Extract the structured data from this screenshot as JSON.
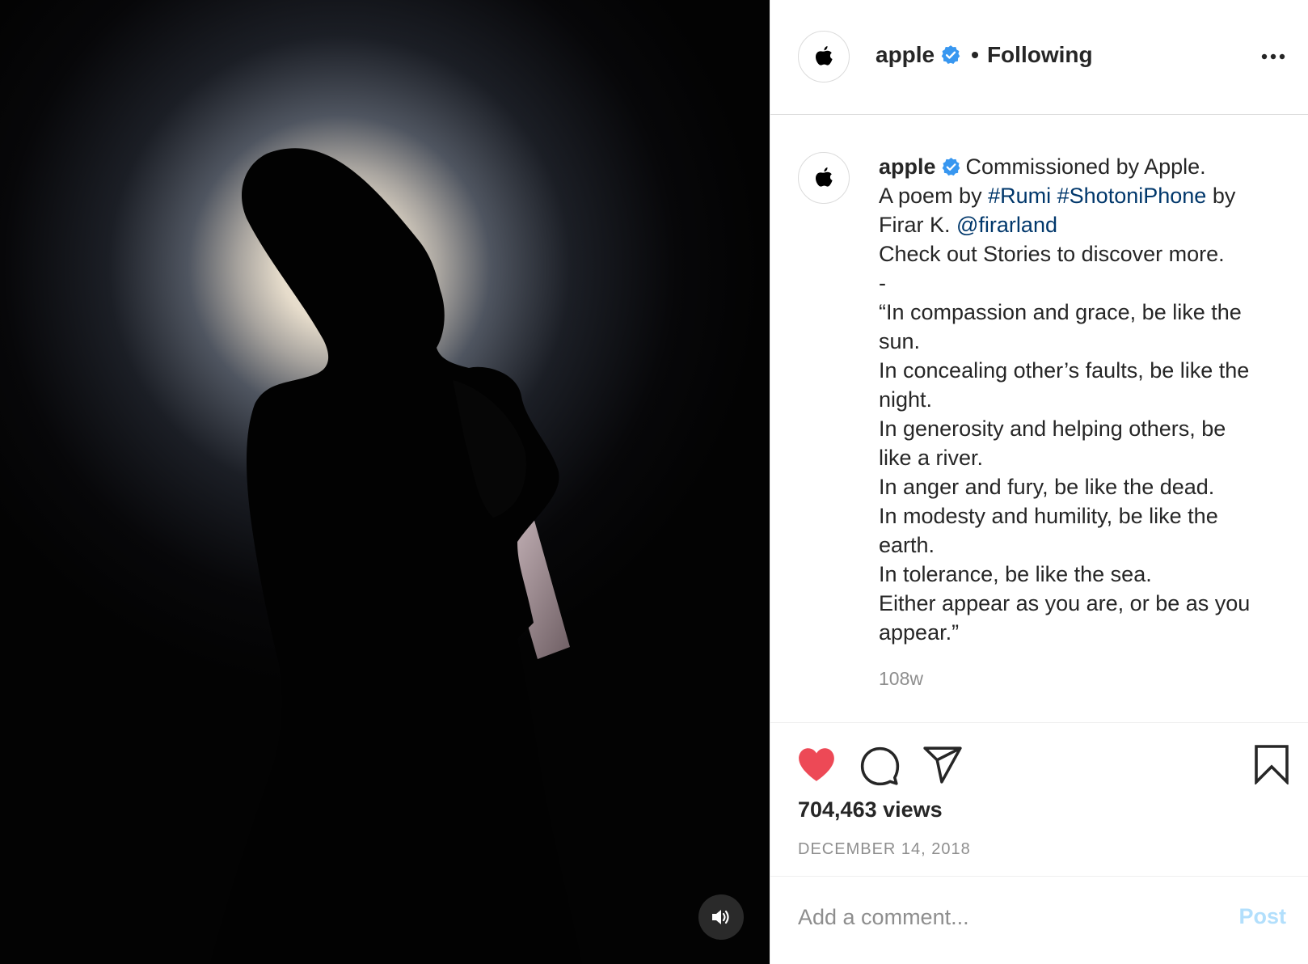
{
  "colors": {
    "verified_blue": "#3897f0",
    "like_red": "#ed4956",
    "link_blue": "#00376b",
    "muted_gray": "#8e8e8e",
    "post_disabled": "#b2dffc"
  },
  "header": {
    "username": "apple",
    "separator": "•",
    "follow_status": "Following",
    "avatar_icon": "apple-logo-icon",
    "more_icon": "more-options-icon"
  },
  "caption": {
    "username": "apple",
    "lines": [
      [
        {
          "text": "Commissioned by Apple."
        }
      ],
      [
        {
          "text": "A poem by "
        },
        {
          "text": "#Rumi",
          "link": true
        },
        {
          "text": " "
        },
        {
          "text": "#ShotoniPhone",
          "link": true
        },
        {
          "text": " by"
        }
      ],
      [
        {
          "text": "Firar K. "
        },
        {
          "text": "@firarland",
          "link": true
        }
      ],
      [
        {
          "text": "Check out Stories to discover more."
        }
      ],
      [
        {
          "text": "-"
        }
      ],
      [
        {
          "text": "“In compassion and grace, be like the"
        }
      ],
      [
        {
          "text": "sun."
        }
      ],
      [
        {
          "text": "In concealing other’s faults, be like the"
        }
      ],
      [
        {
          "text": "night."
        }
      ],
      [
        {
          "text": "In generosity and helping others, be"
        }
      ],
      [
        {
          "text": "like a river."
        }
      ],
      [
        {
          "text": "In anger and fury, be like the dead."
        }
      ],
      [
        {
          "text": "In modesty and humility, be like the"
        }
      ],
      [
        {
          "text": "earth."
        }
      ],
      [
        {
          "text": "In tolerance, be like the sea."
        }
      ],
      [
        {
          "text": "Either appear as you are, or be as you"
        }
      ],
      [
        {
          "text": "appear.”"
        }
      ]
    ],
    "time_ago": "108w"
  },
  "actions": {
    "liked": true,
    "icons": [
      "heart-icon",
      "comment-icon",
      "share-icon",
      "bookmark-icon"
    ],
    "views": "704,463 views",
    "date": "DECEMBER 14, 2018"
  },
  "comment": {
    "placeholder": "Add a comment...",
    "post_label": "Post"
  },
  "media": {
    "type": "video",
    "sound_icon": "speaker-icon"
  }
}
